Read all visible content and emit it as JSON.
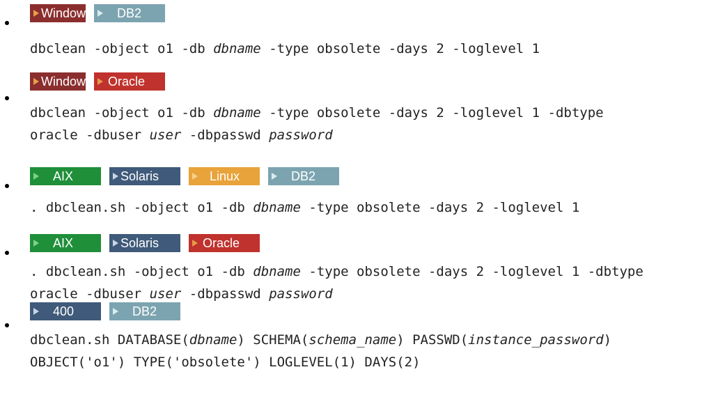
{
  "colors": {
    "windows": "#8B2E2E",
    "windows_arrow": "#e5a04a",
    "db2": "#7ca4b0",
    "db2_text": "#ffffff",
    "db2_arrow": "#d8ecef",
    "oracle": "#c0322d",
    "oracle_arrow": "#e59a4a",
    "aix": "#1f8f3a",
    "aix_arrow": "#7fd08a",
    "solaris": "#3f5a7a",
    "solaris_arrow": "#c8d6e8",
    "linux": "#e8a33a",
    "linux_arrow": "#f7d08a",
    "i400": "#3f5a7a",
    "i400_arrow": "#c8d6e8"
  },
  "entries": [
    {
      "tags": [
        {
          "icon": "triangle-right-icon",
          "label": "Windows"
        },
        {
          "icon": "triangle-right-icon",
          "label": "DB2"
        }
      ],
      "code": [
        [
          {
            "t": "dbclean -object o1 -db "
          },
          {
            "t": "dbname",
            "italic": true
          },
          {
            "t": " -type obsolete -days 2 -loglevel 1"
          }
        ]
      ]
    },
    {
      "tags": [
        {
          "icon": "triangle-right-icon",
          "label": "Windows"
        },
        {
          "icon": "triangle-right-icon",
          "label": "Oracle"
        }
      ],
      "code": [
        [
          {
            "t": "dbclean -object o1 -db "
          },
          {
            "t": "dbname",
            "italic": true
          },
          {
            "t": " -type obsolete -days 2 -loglevel 1 -dbtype"
          }
        ],
        [
          {
            "t": "oracle -dbuser "
          },
          {
            "t": "user",
            "italic": true
          },
          {
            "t": " -dbpasswd "
          },
          {
            "t": "password",
            "italic": true
          }
        ]
      ]
    },
    {
      "tags": [
        {
          "icon": "triangle-right-icon",
          "label": "AIX"
        },
        {
          "icon": "triangle-right-icon",
          "label": "Solaris"
        },
        {
          "icon": "triangle-right-icon",
          "label": "Linux"
        },
        {
          "icon": "triangle-right-icon",
          "label": "DB2"
        }
      ],
      "code": [
        [
          {
            "t": ". dbclean.sh -object o1 -db "
          },
          {
            "t": "dbname",
            "italic": true
          },
          {
            "t": " -type obsolete -days 2 -loglevel 1"
          }
        ]
      ]
    },
    {
      "tags": [
        {
          "icon": "triangle-right-icon",
          "label": "AIX"
        },
        {
          "icon": "triangle-right-icon",
          "label": "Solaris"
        },
        {
          "icon": "triangle-right-icon",
          "label": "Oracle"
        }
      ],
      "code": [
        [
          {
            "t": ". dbclean.sh -object o1 -db "
          },
          {
            "t": "dbname",
            "italic": true
          },
          {
            "t": " -type obsolete -days 2 -loglevel 1 -dbtype"
          }
        ],
        [
          {
            "t": "oracle -dbuser "
          },
          {
            "t": "user",
            "italic": true
          },
          {
            "t": " -dbpasswd "
          },
          {
            "t": "password",
            "italic": true
          }
        ]
      ]
    },
    {
      "tags": [
        {
          "icon": "triangle-right-icon",
          "label": "400"
        },
        {
          "icon": "triangle-right-icon",
          "label": "DB2"
        }
      ],
      "code": [
        [
          {
            "t": "dbclean.sh DATABASE("
          },
          {
            "t": "dbname",
            "italic": true
          },
          {
            "t": ") SCHEMA("
          },
          {
            "t": "schema_name",
            "italic": true
          },
          {
            "t": ") PASSWD("
          },
          {
            "t": "instance_password",
            "italic": true
          },
          {
            "t": ")"
          }
        ],
        [
          {
            "t": "OBJECT('o1') TYPE('obsolete') LOGLEVEL(1) DAYS(2)"
          }
        ]
      ]
    }
  ]
}
